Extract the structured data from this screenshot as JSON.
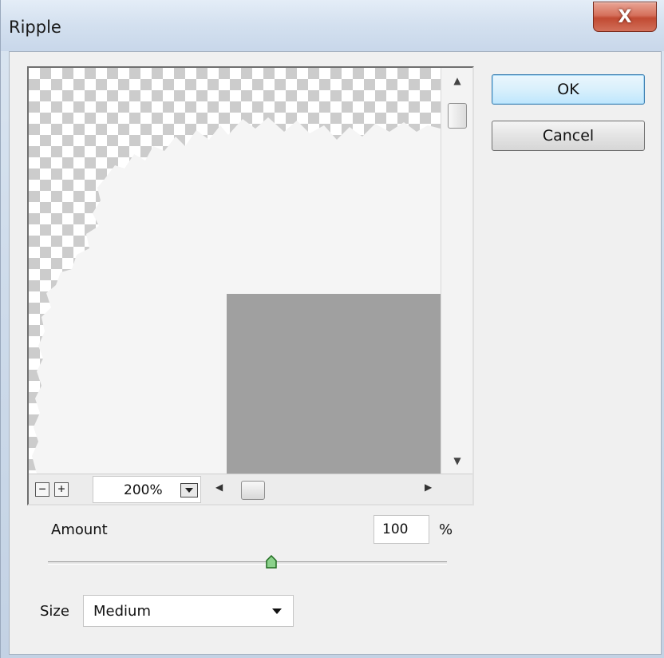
{
  "window": {
    "title": "Ripple",
    "close_label": "X"
  },
  "preview": {
    "zoom_minus": "−",
    "zoom_plus": "+",
    "zoom_value": "200%"
  },
  "buttons": {
    "ok": "OK",
    "cancel": "Cancel"
  },
  "amount": {
    "label": "Amount",
    "value": "100",
    "unit": "%",
    "slider_fraction": 0.56
  },
  "size": {
    "label": "Size",
    "selected": "Medium"
  },
  "colors": {
    "canvas_fill": "#f5f5f5",
    "gray_block": "#a0a0a0",
    "default_button_border": "#3c7fb1"
  }
}
